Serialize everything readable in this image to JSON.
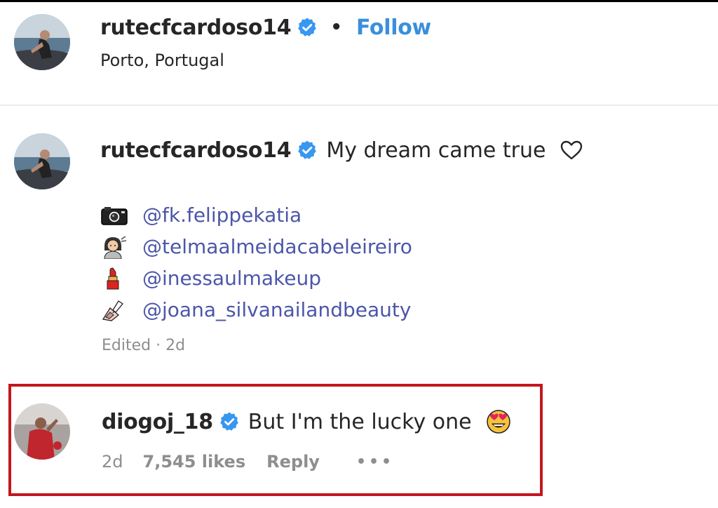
{
  "post_header": {
    "username": "rutecfcardoso14",
    "separator": "•",
    "follow_label": "Follow",
    "location": "Porto, Portugal",
    "avatar_icon": "profile-photo"
  },
  "caption": {
    "username": "rutecfcardoso14",
    "text": "My dream came true",
    "heart_icon": "heart-outline-icon",
    "mentions": [
      {
        "icon": "camera-icon",
        "handle": "@fk.felippekatia"
      },
      {
        "icon": "hairdresser-icon",
        "handle": "@telmaalmeidacabeleireiro"
      },
      {
        "icon": "lipstick-icon",
        "handle": "@inessaulmakeup"
      },
      {
        "icon": "nail-polish-icon",
        "handle": "@joana_silvanailandbeauty"
      }
    ],
    "meta": "Edited · 2d"
  },
  "comment": {
    "username": "diogoj_18",
    "text": "But I'm the lucky one",
    "emoji": "heart-eyes-emoji",
    "time": "2d",
    "likes": "7,545 likes",
    "reply_label": "Reply",
    "more_label": "•••"
  },
  "colors": {
    "follow": "#3a8fdc",
    "verified": "#3897f0",
    "mention": "#4c56a8",
    "highlight_border": "#c4161c",
    "meta_gray": "#8e8e8e"
  }
}
